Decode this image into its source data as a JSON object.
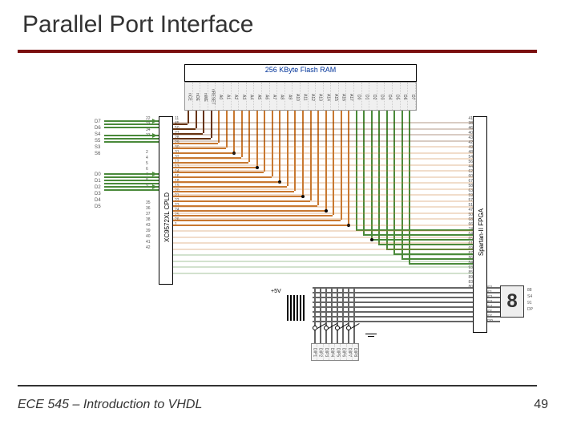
{
  "title": "Parallel Port Interface",
  "footer": {
    "course": "ECE 545 – Introduction to VHDL",
    "page": "49"
  },
  "flashram": {
    "label": "256 KByte Flash RAM"
  },
  "flashram_pins": [
    "nCE",
    "nOE",
    "nWE",
    "nRESET",
    "A0",
    "A1",
    "A2",
    "A3",
    "A4",
    "A5",
    "A6",
    "A7",
    "A8",
    "A9",
    "A10",
    "A11",
    "A12",
    "A13",
    "A14",
    "A15",
    "A16",
    "A17",
    "D0",
    "D1",
    "D2",
    "D3",
    "D4",
    "D5",
    "D6",
    "D7"
  ],
  "cpld": {
    "label": "XC9572XL CPLD"
  },
  "fpga": {
    "label": "Spartan-II FPGA"
  },
  "fpga_pins_left": [
    "41",
    "38",
    "46",
    "40",
    "43",
    "42",
    "49",
    "48",
    "54",
    "56",
    "44",
    "62",
    "60",
    "67",
    "58",
    "63",
    "59",
    "57",
    "51",
    "47",
    "50",
    "68",
    "66",
    "74",
    "64",
    "65",
    "61",
    "69",
    "87",
    "86",
    "84",
    "93",
    "85",
    "89",
    "83",
    "80"
  ],
  "cpld_pins_left_a": [
    "22",
    "23",
    "34",
    "33"
  ],
  "cpld_pins_left_b": [
    "2",
    "4",
    "5",
    "6",
    "7",
    "8",
    "9"
  ],
  "cpld_pins_left_c": [
    "35",
    "36",
    "37",
    "38",
    "43",
    "39",
    "40",
    "41",
    "42"
  ],
  "cpld_pins_right": [
    "11",
    "45",
    "50",
    "27",
    "28",
    "29",
    "30",
    "31",
    "32",
    "12",
    "13",
    "14",
    "16",
    "18",
    "19",
    "20",
    "21",
    "22",
    "23",
    "24",
    "25",
    "26",
    "1"
  ],
  "port_labels_a": [
    "D7",
    "D6",
    "S4",
    "S5",
    "S3",
    "S6"
  ],
  "port_labels_b": [
    "D0",
    "D1",
    "D2",
    "D3",
    "D4",
    "D5"
  ],
  "seven_seg": {
    "digit": "8",
    "pins_left": [
      "S0",
      "S1",
      "S2",
      "S3",
      "S4",
      "S5",
      "S6",
      "DP"
    ],
    "pins_right": [
      "88",
      "S4",
      "91",
      "DP"
    ]
  },
  "voltage": "+5V",
  "dip_labels": [
    "DIP1",
    "DIP2",
    "DIP3",
    "DIP4",
    "DIP5",
    "DIP6",
    "DIP7",
    "DIP8"
  ]
}
